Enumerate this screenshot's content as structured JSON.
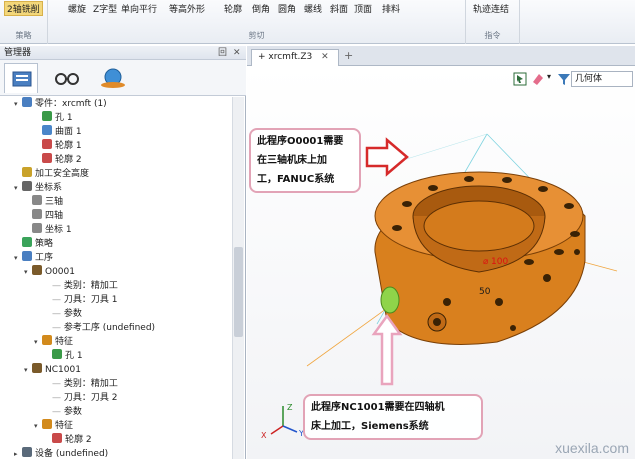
{
  "ribbon": {
    "groups": [
      {
        "label": "策略",
        "items": [
          "2轴铣削"
        ]
      },
      {
        "label": "剪切",
        "items": [
          "螺旋",
          "Z字型",
          "单向平行",
          "等高外形",
          "轮廓",
          "倒角",
          "圆角",
          "螺线",
          "斜面",
          "顶面",
          "排料"
        ]
      },
      {
        "label": "指令",
        "items": [
          "轨迹连结"
        ]
      }
    ]
  },
  "manager": {
    "title": "管理器",
    "controls": [
      "回",
      "✕"
    ],
    "tabs": [
      "part-tree-tab",
      "view-tab",
      "render-tab"
    ]
  },
  "tree": [
    {
      "label": "零件：xrcmft (1)",
      "indent": 1,
      "icon": "part-icon",
      "expand": "▾"
    },
    {
      "label": "孔 1",
      "indent": 3,
      "icon": "hole-icon",
      "expand": ""
    },
    {
      "label": "曲面 1",
      "indent": 3,
      "icon": "surface-icon",
      "expand": ""
    },
    {
      "label": "轮廓 1",
      "indent": 3,
      "icon": "contour-icon",
      "expand": ""
    },
    {
      "label": "轮廓 2",
      "indent": 3,
      "icon": "contour-icon",
      "expand": ""
    },
    {
      "label": "加工安全高度",
      "indent": 1,
      "icon": "safety-height-icon",
      "expand": ""
    },
    {
      "label": "坐标系",
      "indent": 1,
      "icon": "coordinate-icon",
      "expand": "▾"
    },
    {
      "label": "三轴",
      "indent": 2,
      "icon": "axis-icon",
      "expand": ""
    },
    {
      "label": "四轴",
      "indent": 2,
      "icon": "axis-icon",
      "expand": ""
    },
    {
      "label": "坐标 1",
      "indent": 2,
      "icon": "axis-icon",
      "expand": ""
    },
    {
      "label": "策略",
      "indent": 1,
      "icon": "strategy-icon",
      "expand": ""
    },
    {
      "label": "工序",
      "indent": 1,
      "icon": "operation-icon",
      "expand": "▾"
    },
    {
      "label": "O0001",
      "indent": 2,
      "icon": "program-icon",
      "expand": "▾"
    },
    {
      "label": "类别：精加工",
      "indent": 4,
      "icon": "",
      "expand": ""
    },
    {
      "label": "刀具：刀具 1",
      "indent": 4,
      "icon": "",
      "expand": ""
    },
    {
      "label": "参数",
      "indent": 4,
      "icon": "",
      "expand": ""
    },
    {
      "label": "参考工序 (undefined)",
      "indent": 4,
      "icon": "",
      "expand": ""
    },
    {
      "label": "特征",
      "indent": 3,
      "icon": "feature-icon",
      "expand": "▾"
    },
    {
      "label": "孔 1",
      "indent": 4,
      "icon": "hole-icon",
      "expand": ""
    },
    {
      "label": "NC1001",
      "indent": 2,
      "icon": "program-icon",
      "expand": "▾"
    },
    {
      "label": "类别：精加工",
      "indent": 4,
      "icon": "",
      "expand": ""
    },
    {
      "label": "刀具：刀具 2",
      "indent": 4,
      "icon": "",
      "expand": ""
    },
    {
      "label": "参数",
      "indent": 4,
      "icon": "",
      "expand": ""
    },
    {
      "label": "特征",
      "indent": 3,
      "icon": "feature-icon",
      "expand": "▾"
    },
    {
      "label": "轮廓 2",
      "indent": 4,
      "icon": "contour-icon",
      "expand": ""
    },
    {
      "label": "设备 (undefined)",
      "indent": 1,
      "icon": "device-icon",
      "expand": "▸"
    }
  ],
  "doc": {
    "tab_label": "xrcmft.Z3",
    "close": "✕",
    "add": "+",
    "filter": "几何体"
  },
  "viewport": {
    "callout_top": [
      "此程序O0001需要",
      "在三轴机床上加",
      "工，FANUC系统"
    ],
    "callout_bottom": [
      "此程序NC1001需要在四轴机",
      "床上加工，Siemens系统"
    ],
    "dim_labels": [
      "100",
      "50"
    ],
    "axis_labels": [
      "X",
      "Y",
      "Z"
    ],
    "watermark": "xuexila.com"
  },
  "colors": {
    "part": "#d9801e",
    "part_dark": "#a85a0f",
    "callout_border": "#e2a3b6",
    "arrow_red": "#d62a2a",
    "arrow_pink": "#e9a4bd"
  }
}
